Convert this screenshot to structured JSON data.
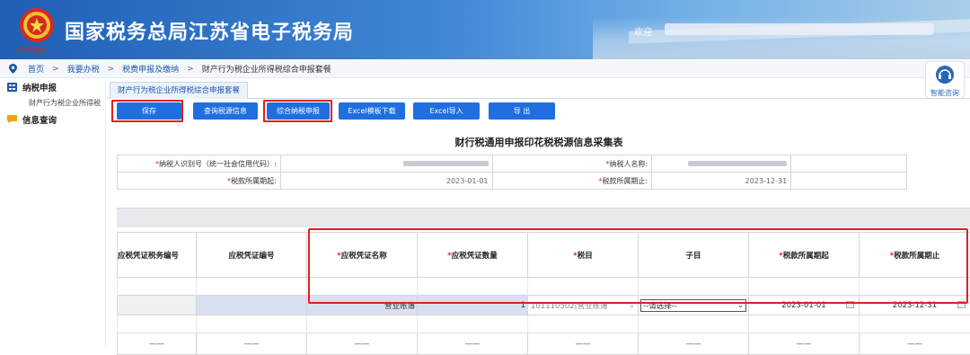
{
  "header": {
    "site_title": "国家税务总局江苏省电子税务局",
    "emblem_caption": "中国税务",
    "welcome": "欢迎"
  },
  "breadcrumb": [
    "首页",
    "我要办税",
    "税费申报及缴纳",
    "财产行为税企业所得税综合申报套餐"
  ],
  "sidebar": {
    "sections": [
      {
        "label": "纳税申报",
        "items": [
          "财产行为税企业所得税"
        ]
      },
      {
        "label": "信息查询",
        "items": []
      }
    ]
  },
  "assistant_label": "智能咨询",
  "tab_label": "财产行为税企业所得税综合申报套餐",
  "toolbar": {
    "save": "保存",
    "query_source": "查询税源信息",
    "combined_declare": "综合纳税申报",
    "excel_template": "Excel模板下载",
    "excel_import": "Excel导入",
    "export": "导 出"
  },
  "form_title": "财行税通用申报印花税税源信息采集表",
  "info": {
    "taxpayer_id_label": "纳税人识别号（统一社会信用代码）:",
    "taxpayer_name_label": "纳税人名称:",
    "period_start_label": "税款所属期起:",
    "period_start_value": "2023-01-01",
    "period_end_label": "税款所属期止:",
    "period_end_value": "2023-12-31",
    "required_mark": "*"
  },
  "grid": {
    "headers": [
      {
        "text": "应税凭证税务编号",
        "required": false
      },
      {
        "text": "应税凭证编号",
        "required": false
      },
      {
        "text": "应税凭证名称",
        "required": true
      },
      {
        "text": "应税凭证数量",
        "required": true
      },
      {
        "text": "税目",
        "required": true
      },
      {
        "text": "子目",
        "required": false
      },
      {
        "text": "税款所属期起",
        "required": true
      },
      {
        "text": "税款所属期止",
        "required": true
      }
    ],
    "row": {
      "voucher_name": "营业账簿",
      "voucher_count": "1",
      "tax_item": "101110502|营业账簿",
      "sub_item": "--请选择--",
      "period_start": "2023-01-01",
      "period_end": "2023-12-31"
    },
    "empty_row_placeholder": "——"
  },
  "colors": {
    "button_blue": "#1f6fe0",
    "highlight_red": "#e02020",
    "link_blue": "#1c56a8"
  }
}
